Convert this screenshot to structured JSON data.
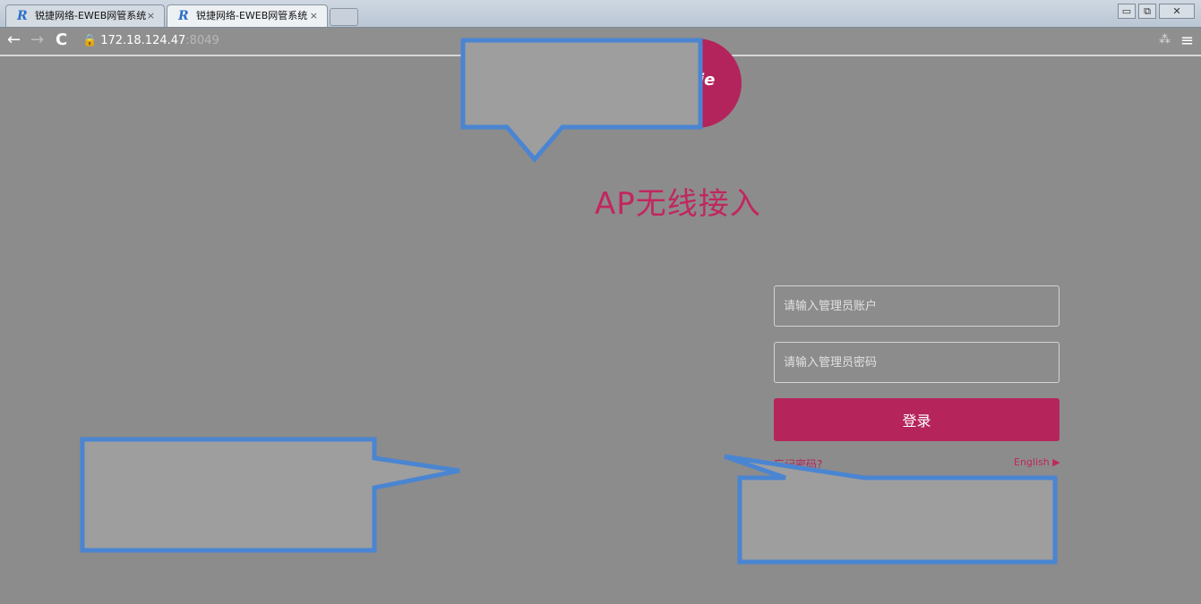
{
  "browser": {
    "tabs": [
      {
        "favicon": "R",
        "title": "锐捷网络-EWEB网管系统",
        "close": "×",
        "active": false
      },
      {
        "favicon": "R",
        "title": "锐捷网络-EWEB网管系统",
        "close": "×",
        "active": true
      }
    ],
    "window_controls": {
      "minimize": "▭",
      "maximize": "⧉",
      "close": "✕"
    },
    "toolbar": {
      "back": "←",
      "forward": "→",
      "reload": "C",
      "lock": "🔒",
      "url_host": "172.18.124.47",
      "url_port": ":8049",
      "extension": "⁂",
      "menu": "≡"
    }
  },
  "page": {
    "logo": {
      "text": "ie"
    },
    "title": "AP无线接入",
    "subtitle": "",
    "login": {
      "username_placeholder": "请输入管理员账户",
      "password_placeholder": "请输入管理员密码",
      "submit_label": "登录"
    },
    "forgot_link": "忘记密码?",
    "language_link": "English ▶"
  },
  "callouts": [
    {
      "id": "top",
      "text": ""
    },
    {
      "id": "left",
      "text": ""
    },
    {
      "id": "right",
      "text": ""
    }
  ],
  "colors": {
    "accent": "#b5245b",
    "callout_border": "#4a85d2",
    "callout_fill": "#9e9e9e",
    "page_background": "#8c8c8c"
  }
}
